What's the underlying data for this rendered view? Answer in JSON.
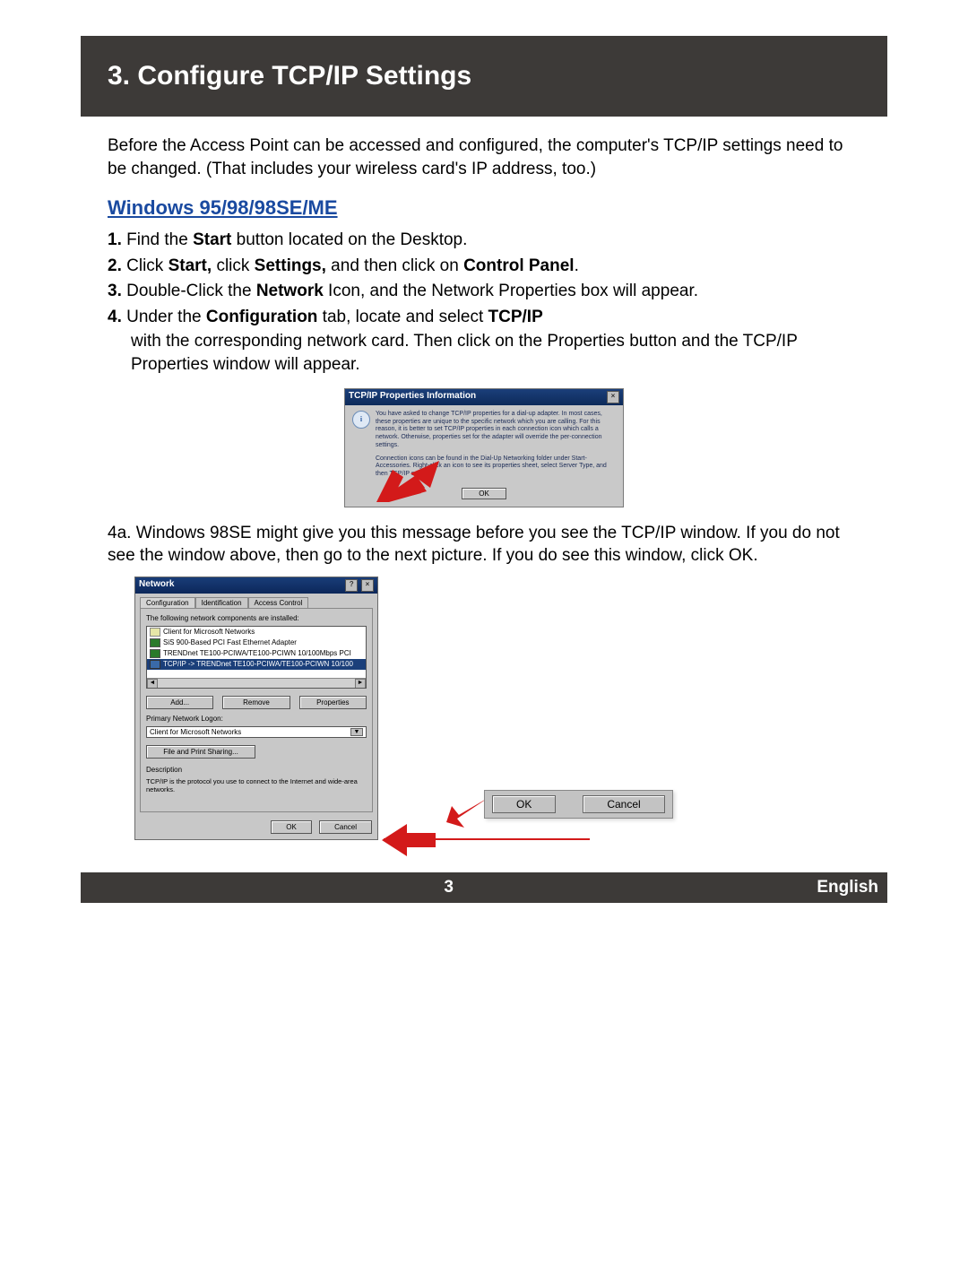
{
  "header": {
    "title": "3. Configure TCP/IP Settings"
  },
  "intro": "Before the Access Point can be accessed and configured, the computer's TCP/IP settings need to be changed. (That includes your wireless card's IP address, too.)",
  "subhead": "Windows 95/98/98SE/ME",
  "steps": {
    "s1": {
      "num": "1.",
      "pre": "Find the ",
      "b1": "Start",
      "post": " button located on the Desktop."
    },
    "s2": {
      "num": "2.",
      "pre": "Click ",
      "b1": "Start,",
      "mid1": " click ",
      "b2": "Settings,",
      "mid2": " and then click on ",
      "b3": "Control Panel",
      "post": "."
    },
    "s3": {
      "num": "3.",
      "pre": "Double-Click the ",
      "b1": "Network",
      "post": " Icon, and the Network Properties box will appear."
    },
    "s4": {
      "num": "4.",
      "pre": "Under the ",
      "b1": "Configuration",
      "mid1": " tab, locate and select ",
      "b2": "TCP/IP",
      "mid2": " with the corresponding network card. Then click on the Properties button and the TCP/IP Properties window will appear."
    }
  },
  "dlg1": {
    "title": "TCP/IP Properties Information",
    "para1": "You have asked to change TCP/IP properties for a dial-up adapter. In most cases, these properties are unique to the specific network which you are calling. For this reason, it is better to set TCP/IP properties in each connection icon which calls a network. Otherwise, properties set for the adapter will override the per-connection settings.",
    "para2": "Connection icons can be found in the Dial-Up Networking folder under Start-Accessories. Right-click an icon to see its properties sheet, select Server Type, and then TCP/IP settings.",
    "ok": "OK"
  },
  "step4a": {
    "num": "4a.",
    "pre": "Windows 98SE might give you this message before you see the TCP/IP window. If you do not see the window above, then go to the next picture.  If you do see this window, click ",
    "b1": "OK",
    "post": "."
  },
  "dlg2": {
    "title": "Network",
    "tabs": {
      "t1": "Configuration",
      "t2": "Identification",
      "t3": "Access Control"
    },
    "list_label": "The following network components are installed:",
    "items": {
      "i1": "Client for Microsoft Networks",
      "i2": "SiS 900-Based PCI Fast Ethernet Adapter",
      "i3": "TRENDnet TE100-PCIWA/TE100-PCIWN 10/100Mbps PCI",
      "i4": "TCP/IP -> TRENDnet TE100-PCIWA/TE100-PCIWN 10/100"
    },
    "btn_add": "Add...",
    "btn_remove": "Remove",
    "btn_props": "Properties",
    "primary_label": "Primary Network Logon:",
    "primary_value": "Client for Microsoft Networks",
    "fps": "File and Print Sharing...",
    "desc_label": "Description",
    "desc_text": "TCP/IP is the protocol you use to connect to the Internet and wide-area networks.",
    "ok": "OK",
    "cancel": "Cancel"
  },
  "callout": {
    "ok": "OK",
    "cancel": "Cancel"
  },
  "footer": {
    "page": "3",
    "lang": "English"
  }
}
